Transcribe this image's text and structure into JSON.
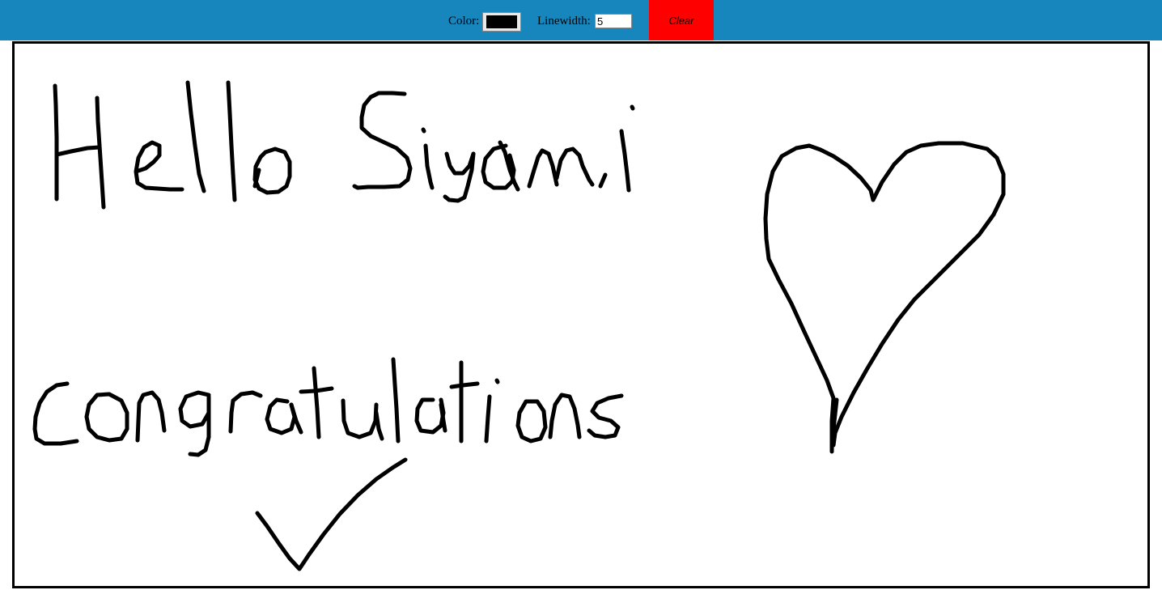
{
  "toolbar": {
    "color_label": "Color:",
    "color_value": "#000000",
    "linewidth_label": "Linewidth:",
    "linewidth_value": "5",
    "clear_label": "Clear",
    "background_color": "#1786bc",
    "clear_button_color": "#ff0000"
  },
  "canvas": {
    "stroke_color": "#000000",
    "stroke_width": 5,
    "drawings": [
      "hello-siyami-handwriting",
      "heart-doodle",
      "congratulations-handwriting",
      "checkmark-doodle"
    ]
  }
}
